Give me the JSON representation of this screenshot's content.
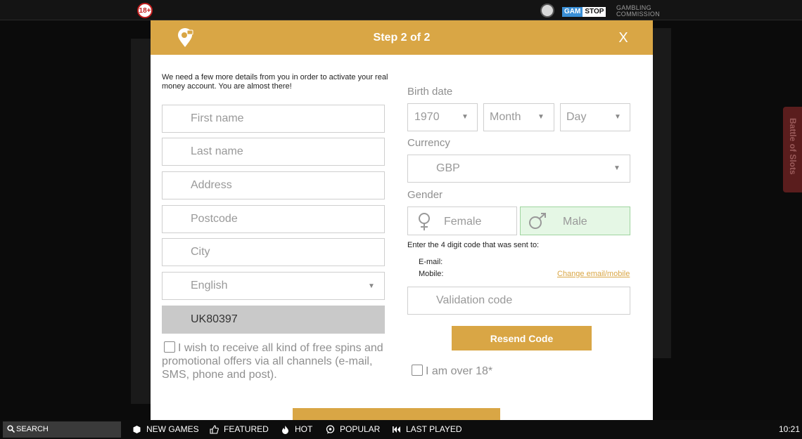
{
  "topbar": {
    "age_badge": "18+",
    "gamstop_left": "GAM",
    "gamstop_right": "STOP",
    "gc_line1": "GAMBLING",
    "gc_line2": "COMMISSION"
  },
  "side_tab": {
    "label": "Battle of Slots"
  },
  "modal": {
    "title": "Step 2 of 2",
    "close_label": "X",
    "intro": "We need a few more details from you in order to activate your real money account. You are almost there!",
    "fields": {
      "first_name": "First name",
      "last_name": "Last name",
      "address": "Address",
      "postcode": "Postcode",
      "city": "City",
      "language": "English",
      "account_code": "UK80397"
    },
    "promo_text": "I wish to receive all kind of free spins and promotional offers via all channels (e-mail, SMS, phone and post).",
    "birth_date": {
      "label": "Birth date",
      "year": "1970",
      "month": "Month",
      "day": "Day"
    },
    "currency": {
      "label": "Currency",
      "value": "GBP"
    },
    "gender": {
      "label": "Gender",
      "female": "Female",
      "male": "Male"
    },
    "code_note": "Enter the 4 digit code that was sent to:",
    "email_label": "E-mail:",
    "mobile_label": "Mobile:",
    "change_link": "Change email/mobile",
    "validation_placeholder": "Validation code",
    "resend_label": "Resend Code",
    "over18_label": "I am over 18*"
  },
  "bottombar": {
    "search": "SEARCH",
    "nav": [
      "NEW GAMES",
      "FEATURED",
      "HOT",
      "POPULAR",
      "LAST PLAYED"
    ],
    "clock": "10:21"
  },
  "colors": {
    "accent": "#d9a645",
    "selected_bg": "#e5f7e5",
    "readonly_bg": "#c9c9c9"
  }
}
